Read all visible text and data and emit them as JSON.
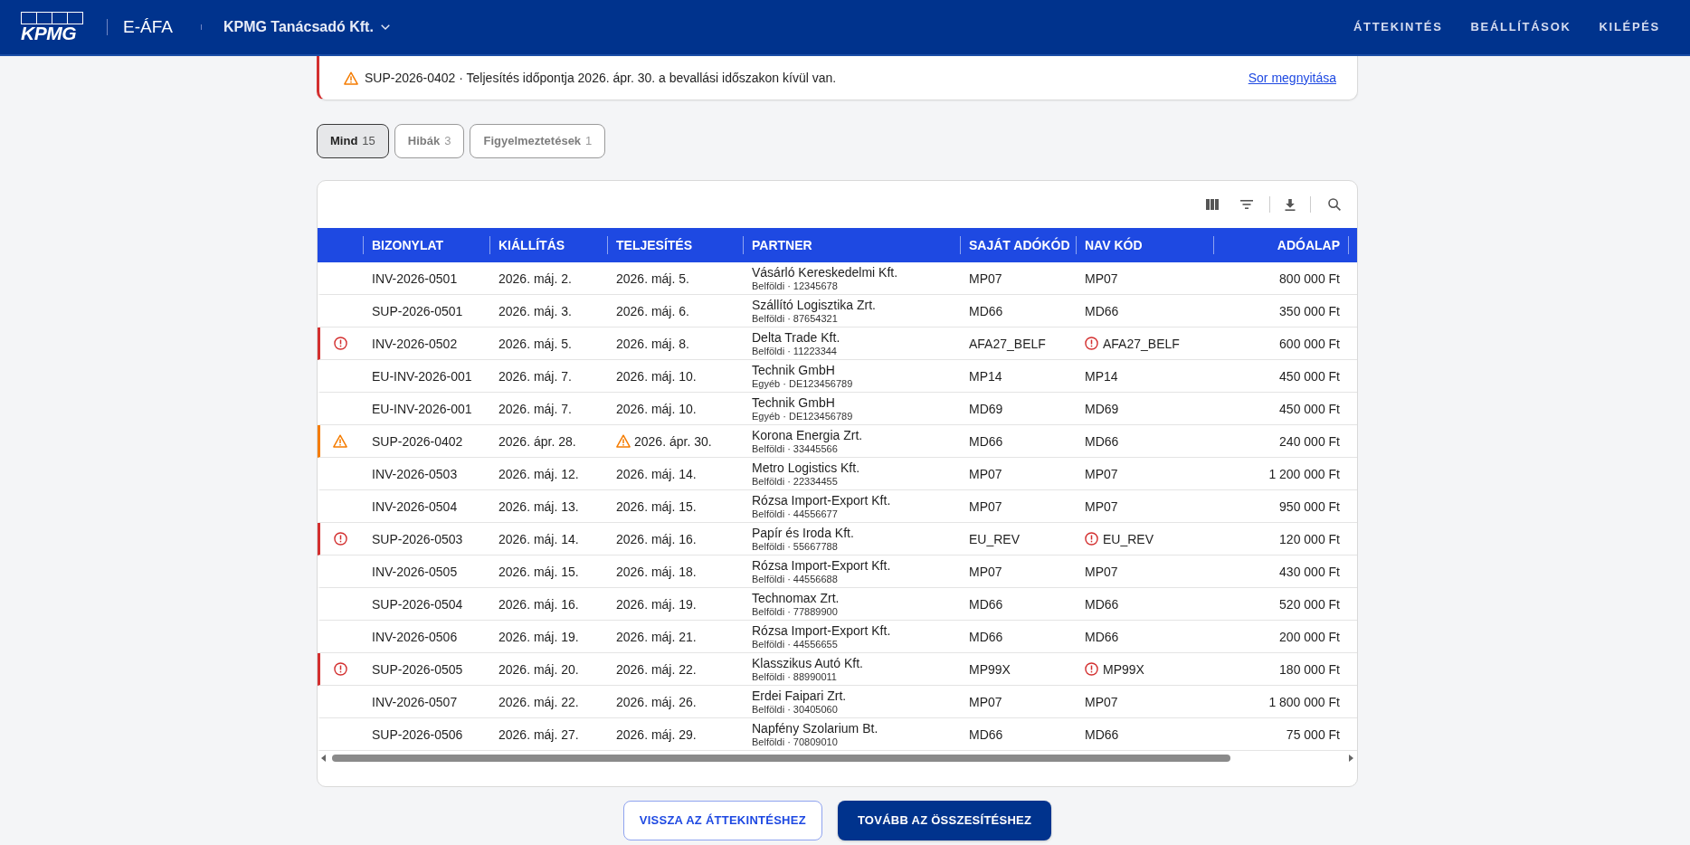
{
  "header": {
    "logo": "KPMG",
    "app_name": "E-ÁFA",
    "company": "KPMG Tanácsadó Kft.",
    "nav": [
      {
        "label": "ÁTTEKINTÉS"
      },
      {
        "label": "BEÁLLÍTÁSOK"
      },
      {
        "label": "KILÉPÉS"
      }
    ]
  },
  "alert": {
    "kind": "warning",
    "message": "SUP-2026-0402 · Teljesítés időpontja 2026. ápr. 30. a bevallási időszakon kívül van.",
    "link": "Sor megnyitása"
  },
  "filters": [
    {
      "label": "Mind",
      "count": "15",
      "selected": true
    },
    {
      "label": "Hibák",
      "count": "3",
      "selected": false
    },
    {
      "label": "Figyelmeztetések",
      "count": "1",
      "selected": false
    }
  ],
  "table": {
    "columns": [
      {
        "label": "BIZONYLAT"
      },
      {
        "label": "KIÁLLÍTÁS"
      },
      {
        "label": "TELJESÍTÉS"
      },
      {
        "label": "PARTNER"
      },
      {
        "label": "SAJÁT ADÓKÓD"
      },
      {
        "label": "NAV KÓD"
      },
      {
        "label": "ADÓALAP"
      }
    ],
    "rows": [
      {
        "kind": "plain",
        "document": "INV-2026-0501",
        "issued": "2026. máj. 2.",
        "performed": "2026. máj. 5.",
        "performed_warning": false,
        "partner": "Vásárló Kereskedelmi Kft.",
        "partner_detail": "Belföldi · 12345678",
        "own_code": "MP07",
        "nav_code": "MP07",
        "nav_code_error": false,
        "tax_base": "800 000 Ft"
      },
      {
        "kind": "plain",
        "document": "SUP-2026-0501",
        "issued": "2026. máj. 3.",
        "performed": "2026. máj. 6.",
        "performed_warning": false,
        "partner": "Szállító Logisztika Zrt.",
        "partner_detail": "Belföldi · 87654321",
        "own_code": "MD66",
        "nav_code": "MD66",
        "nav_code_error": false,
        "tax_base": "350 000 Ft"
      },
      {
        "kind": "error",
        "document": "INV-2026-0502",
        "issued": "2026. máj. 5.",
        "performed": "2026. máj. 8.",
        "performed_warning": false,
        "partner": "Delta Trade Kft.",
        "partner_detail": "Belföldi · 11223344",
        "own_code": "AFA27_BELF",
        "nav_code": "AFA27_BELF",
        "nav_code_error": true,
        "tax_base": "600 000 Ft"
      },
      {
        "kind": "plain",
        "document": "EU-INV-2026-001",
        "issued": "2026. máj. 7.",
        "performed": "2026. máj. 10.",
        "performed_warning": false,
        "partner": "Technik GmbH",
        "partner_detail": "Egyéb · DE123456789",
        "own_code": "MP14",
        "nav_code": "MP14",
        "nav_code_error": false,
        "tax_base": "450 000 Ft"
      },
      {
        "kind": "plain",
        "document": "EU-INV-2026-001",
        "issued": "2026. máj. 7.",
        "performed": "2026. máj. 10.",
        "performed_warning": false,
        "partner": "Technik GmbH",
        "partner_detail": "Egyéb · DE123456789",
        "own_code": "MD69",
        "nav_code": "MD69",
        "nav_code_error": false,
        "tax_base": "450 000 Ft"
      },
      {
        "kind": "warning",
        "document": "SUP-2026-0402",
        "issued": "2026. ápr. 28.",
        "performed": "2026. ápr. 30.",
        "performed_warning": true,
        "partner": "Korona Energia Zrt.",
        "partner_detail": "Belföldi · 33445566",
        "own_code": "MD66",
        "nav_code": "MD66",
        "nav_code_error": false,
        "tax_base": "240 000 Ft"
      },
      {
        "kind": "plain",
        "document": "INV-2026-0503",
        "issued": "2026. máj. 12.",
        "performed": "2026. máj. 14.",
        "performed_warning": false,
        "partner": "Metro Logistics Kft.",
        "partner_detail": "Belföldi · 22334455",
        "own_code": "MP07",
        "nav_code": "MP07",
        "nav_code_error": false,
        "tax_base": "1 200 000 Ft"
      },
      {
        "kind": "plain",
        "document": "INV-2026-0504",
        "issued": "2026. máj. 13.",
        "performed": "2026. máj. 15.",
        "performed_warning": false,
        "partner": "Rózsa Import-Export Kft.",
        "partner_detail": "Belföldi · 44556677",
        "own_code": "MP07",
        "nav_code": "MP07",
        "nav_code_error": false,
        "tax_base": "950 000 Ft"
      },
      {
        "kind": "error",
        "document": "SUP-2026-0503",
        "issued": "2026. máj. 14.",
        "performed": "2026. máj. 16.",
        "performed_warning": false,
        "partner": "Papír és Iroda Kft.",
        "partner_detail": "Belföldi · 55667788",
        "own_code": "EU_REV",
        "nav_code": "EU_REV",
        "nav_code_error": true,
        "tax_base": "120 000 Ft"
      },
      {
        "kind": "plain",
        "document": "INV-2026-0505",
        "issued": "2026. máj. 15.",
        "performed": "2026. máj. 18.",
        "performed_warning": false,
        "partner": "Rózsa Import-Export Kft.",
        "partner_detail": "Belföldi · 44556688",
        "own_code": "MP07",
        "nav_code": "MP07",
        "nav_code_error": false,
        "tax_base": "430 000 Ft"
      },
      {
        "kind": "plain",
        "document": "SUP-2026-0504",
        "issued": "2026. máj. 16.",
        "performed": "2026. máj. 19.",
        "performed_warning": false,
        "partner": "Technomax Zrt.",
        "partner_detail": "Belföldi · 77889900",
        "own_code": "MD66",
        "nav_code": "MD66",
        "nav_code_error": false,
        "tax_base": "520 000 Ft"
      },
      {
        "kind": "plain",
        "document": "INV-2026-0506",
        "issued": "2026. máj. 19.",
        "performed": "2026. máj. 21.",
        "performed_warning": false,
        "partner": "Rózsa Import-Export Kft.",
        "partner_detail": "Belföldi · 44556655",
        "own_code": "MD66",
        "nav_code": "MD66",
        "nav_code_error": false,
        "tax_base": "200 000 Ft"
      },
      {
        "kind": "error",
        "document": "SUP-2026-0505",
        "issued": "2026. máj. 20.",
        "performed": "2026. máj. 22.",
        "performed_warning": false,
        "partner": "Klasszikus Autó Kft.",
        "partner_detail": "Belföldi · 88990011",
        "own_code": "MP99X",
        "nav_code": "MP99X",
        "nav_code_error": true,
        "tax_base": "180 000 Ft"
      },
      {
        "kind": "plain",
        "document": "INV-2026-0507",
        "issued": "2026. máj. 22.",
        "performed": "2026. máj. 26.",
        "performed_warning": false,
        "partner": "Erdei Faipari Zrt.",
        "partner_detail": "Belföldi · 30405060",
        "own_code": "MP07",
        "nav_code": "MP07",
        "nav_code_error": false,
        "tax_base": "1 800 000 Ft"
      },
      {
        "kind": "plain",
        "document": "SUP-2026-0506",
        "issued": "2026. máj. 27.",
        "performed": "2026. máj. 29.",
        "performed_warning": false,
        "partner": "Napfény Szolarium Bt.",
        "partner_detail": "Belföldi · 70809010",
        "own_code": "MD66",
        "nav_code": "MD66",
        "nav_code_error": false,
        "tax_base": "75 000 Ft"
      }
    ]
  },
  "actions": [
    {
      "label": "VISSZA AZ ÁTTEKINTÉSHEZ",
      "kind": "secondary"
    },
    {
      "label": "TOVÁBB AZ ÖSSZESÍTÉSHEZ",
      "kind": "primary"
    }
  ]
}
